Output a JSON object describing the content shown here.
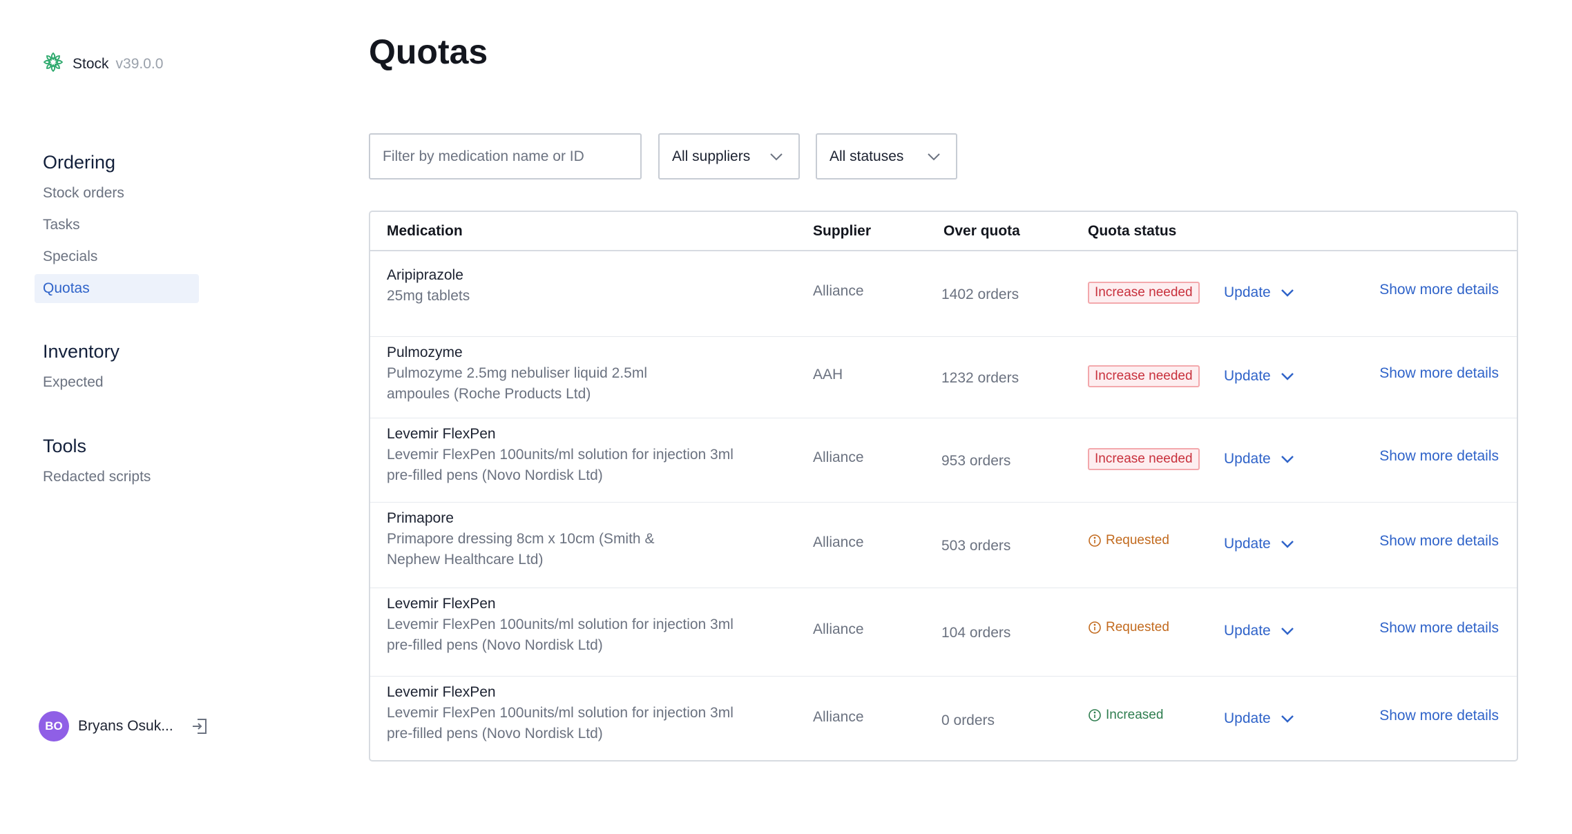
{
  "app": {
    "name": "Stock",
    "version": "v39.0.0",
    "icon": "leaf-ring-icon"
  },
  "sidebar": {
    "sections": [
      {
        "heading": "Ordering",
        "items": [
          "Stock orders",
          "Tasks",
          "Specials",
          "Quotas"
        ]
      },
      {
        "heading": "Inventory",
        "items": [
          "Expected"
        ]
      },
      {
        "heading": "Tools",
        "items": [
          "Redacted scripts"
        ]
      }
    ],
    "active_item": "Quotas"
  },
  "user": {
    "initials": "BO",
    "name": "Bryans Osuk...",
    "logout_icon": "logout-icon"
  },
  "page": {
    "title": "Quotas"
  },
  "filters": {
    "search_placeholder": "Filter by medication name or ID",
    "search_value": "",
    "supplier": "All suppliers",
    "status": "All statuses"
  },
  "table": {
    "columns": {
      "medication": "Medication",
      "supplier": "Supplier",
      "over_quota": "Over quota",
      "quota_status": "Quota status"
    },
    "rows": [
      {
        "name": "Aripiprazole",
        "desc1": "25mg tablets",
        "desc2": "",
        "supplier": "Alliance",
        "over_quota": "1402 orders",
        "status": "Increase needed",
        "status_type": "increase",
        "update": "Update",
        "details": "Show more details"
      },
      {
        "name": "Pulmozyme",
        "desc1": "Pulmozyme 2.5mg nebuliser liquid 2.5ml",
        "desc2": "ampoules (Roche Products Ltd)",
        "supplier": "AAH",
        "over_quota": "1232 orders",
        "status": "Increase needed",
        "status_type": "increase",
        "update": "Update",
        "details": "Show more details"
      },
      {
        "name": "Levemir FlexPen",
        "desc1": "Levemir FlexPen 100units/ml solution for injection 3ml",
        "desc2": "pre-filled pens (Novo Nordisk Ltd)",
        "supplier": "Alliance",
        "over_quota": "953 orders",
        "status": "Increase needed",
        "status_type": "increase",
        "update": "Update",
        "details": "Show more details"
      },
      {
        "name": "Primapore",
        "desc1": "Primapore dressing 8cm x 10cm (Smith &",
        "desc2": "Nephew Healthcare Ltd)",
        "supplier": "Alliance",
        "over_quota": "503 orders",
        "status": "Requested",
        "status_type": "requested",
        "update": "Update",
        "details": "Show more details"
      },
      {
        "name": "Levemir FlexPen",
        "desc1": "Levemir FlexPen 100units/ml solution for injection 3ml",
        "desc2": "pre-filled pens (Novo Nordisk Ltd)",
        "supplier": "Alliance",
        "over_quota": "104 orders",
        "status": "Requested",
        "status_type": "requested",
        "update": "Update",
        "details": "Show more details"
      },
      {
        "name": "Levemir FlexPen",
        "desc1": "Levemir FlexPen 100units/ml solution for injection 3ml",
        "desc2": "pre-filled pens (Novo Nordisk Ltd)",
        "supplier": "Alliance",
        "over_quota": "0 orders",
        "status": "Increased",
        "status_type": "increased",
        "update": "Update",
        "details": "Show more details"
      }
    ]
  },
  "colors": {
    "accent": "#2f63c9",
    "danger": "#c8303c",
    "warning": "#c26a1e",
    "success": "#2e7d4f",
    "avatar": "#8f5fe6"
  }
}
